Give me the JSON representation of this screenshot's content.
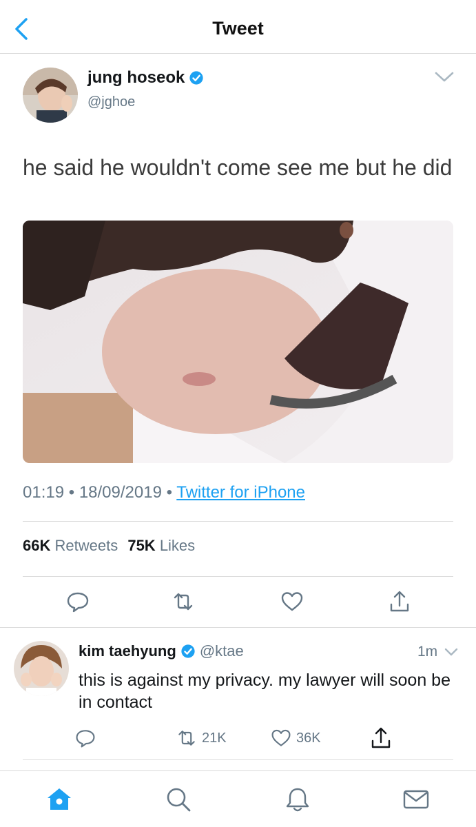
{
  "header": {
    "title": "Tweet"
  },
  "tweet": {
    "author_name": "jung hoseok",
    "author_handle": "@jghoe",
    "text": "he said he wouldn't come see me but he did",
    "time": "01:19",
    "date": "18/09/2019",
    "source": "Twitter for iPhone",
    "retweets_count": "66K",
    "retweets_label": "Retweets",
    "likes_count": "75K",
    "likes_label": "Likes"
  },
  "reply": {
    "author_name": "kim taehyung",
    "author_handle": "@ktae",
    "time": "1m",
    "text": "this is against my privacy. my lawyer will soon be in contact",
    "retweets": "21K",
    "likes": "36K"
  },
  "icons": {
    "back": "chevron-left-icon",
    "verified": "verified-badge-icon",
    "more": "chevron-down-icon",
    "reply": "speech-bubble-icon",
    "retweet": "retweet-icon",
    "like": "heart-icon",
    "share": "share-icon",
    "home": "home-icon",
    "search": "search-icon",
    "notifications": "bell-icon",
    "messages": "envelope-icon"
  },
  "colors": {
    "accent": "#1da1f2",
    "secondary_text": "#657786",
    "divider": "#dcdcdc"
  }
}
